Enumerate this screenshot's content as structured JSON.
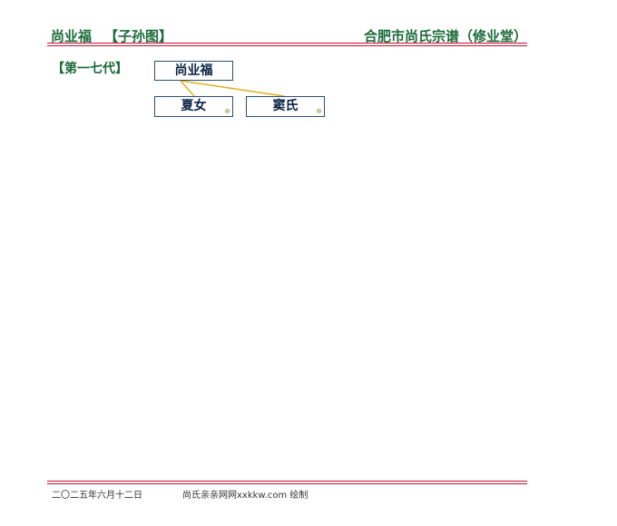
{
  "header": {
    "person_name": "尚业福",
    "chart_type": "【子孙图】",
    "genealogy_title": "合肥市尚氏宗谱（修业堂）"
  },
  "generation_label": "【第一七代】",
  "tree": {
    "root": {
      "name": "尚业福"
    },
    "spouses": [
      {
        "name": "夏女",
        "mark": "⊕"
      },
      {
        "name": "窦氏",
        "mark": "⊕"
      }
    ]
  },
  "footer": {
    "date": "二〇二五年六月十二日",
    "credit": "尚氏亲亲网网xxkkw.com 绘制"
  },
  "colors": {
    "title_green": "#1a6b3a",
    "rule_red": "#c8102e",
    "connector_gold": "#e0b020",
    "node_border": "#2f4f6f"
  }
}
